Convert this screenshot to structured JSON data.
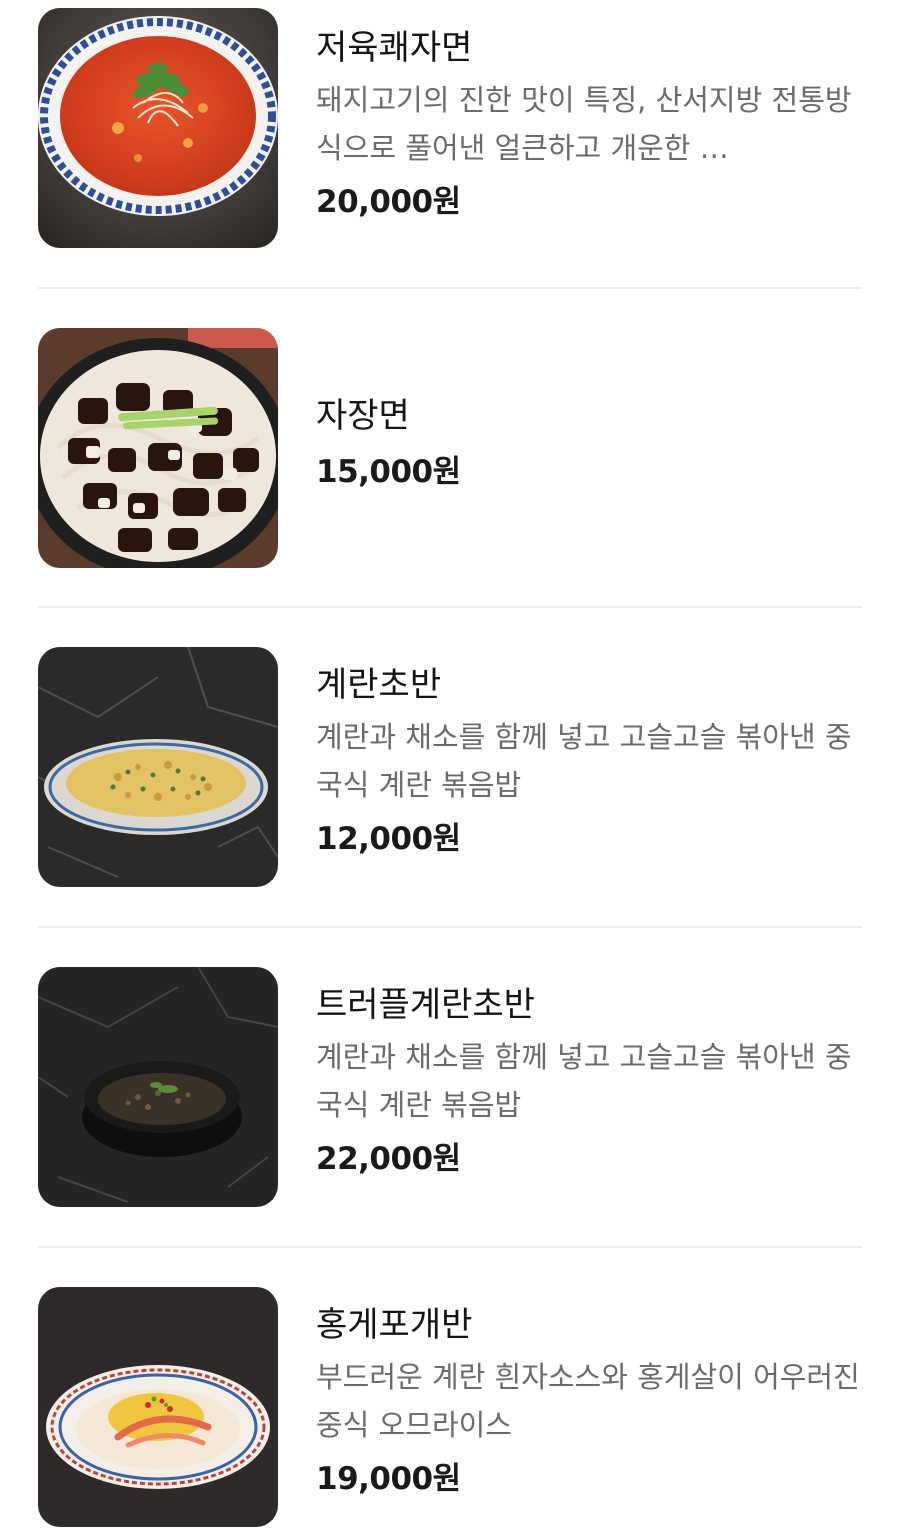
{
  "menu": {
    "items": [
      {
        "name": "저육쾌자면",
        "description": "돼지고기의 진한 맛이 특징, 산서지방 전통방식으로 풀어낸 얼큰하고 개운한 …",
        "price": "20,000원",
        "image_icon": "spicy-pork-noodle-photo"
      },
      {
        "name": "자장면",
        "description": "",
        "price": "15,000원",
        "image_icon": "jajangmyeon-photo"
      },
      {
        "name": "계란초반",
        "description": "계란과 채소를 함께 넣고 고슬고슬 볶아낸 중국식 계란 볶음밥",
        "price": "12,000원",
        "image_icon": "egg-fried-rice-photo"
      },
      {
        "name": "트러플계란초반",
        "description": "계란과 채소를 함께 넣고 고슬고슬 볶아낸 중국식 계란 볶음밥",
        "price": "22,000원",
        "image_icon": "truffle-fried-rice-photo"
      },
      {
        "name": "홍게포개반",
        "description": "부드러운 계란 흰자소스와 홍게살이 어우러진 중식 오므라이스",
        "price": "19,000원",
        "image_icon": "crab-omelet-rice-photo"
      }
    ]
  },
  "colors": {
    "text_primary": "#151515",
    "text_secondary": "#6b6b6b",
    "divider": "#ececec",
    "background": "#ffffff"
  }
}
